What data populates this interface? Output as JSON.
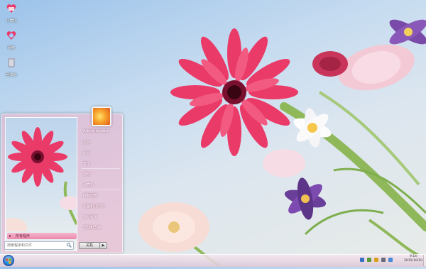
{
  "desktop": {
    "icons": [
      {
        "label": "计算机",
        "icon": "computer-heart-icon"
      },
      {
        "label": "网络",
        "icon": "network-heart-icon"
      },
      {
        "label": "回收站",
        "icon": "recycle-bin-icon"
      }
    ]
  },
  "start_menu": {
    "all_programs": "所有程序",
    "search": {
      "placeholder": "搜索程序和文件"
    },
    "user": "Administrator",
    "items": [
      "文档",
      "图片",
      "音乐",
      "游戏",
      "计算机",
      "控制面板",
      "设备和打印机",
      "默认程序",
      "帮助和支持"
    ],
    "shutdown": "关机",
    "shutdown_arrow": "▶"
  },
  "taskbar": {
    "clock_time": "9:14",
    "clock_date": "2015/10/10"
  },
  "colors": {
    "accent": "#e98aad",
    "sky": "#9cc3ea",
    "flower": "#e8335f"
  }
}
